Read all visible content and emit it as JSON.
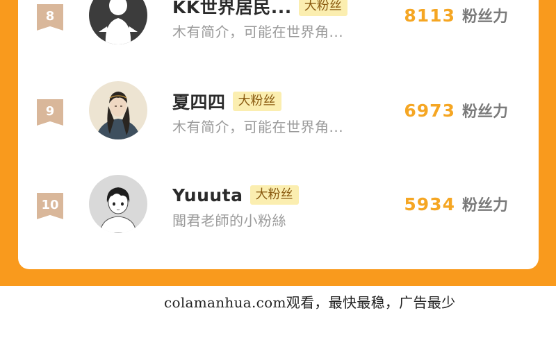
{
  "colors": {
    "frame_orange": "#f99a1d",
    "card_white": "#ffffff",
    "rank_badge": "#d9b79a",
    "fan_badge_bg": "#fbeeb0",
    "score_orange": "#f5a623",
    "bio_gray": "#9a9a9a"
  },
  "leaderboard": {
    "rows": [
      {
        "rank": "8",
        "avatar_icon": "default-ghost-avatar-icon",
        "name": "KK世界居民...",
        "badge": "大粉丝",
        "bio": "木有简介，可能在世界角...",
        "score": "8113",
        "score_unit": "粉丝力"
      },
      {
        "rank": "9",
        "avatar_icon": "illustrated-character-avatar-icon",
        "name": "夏四四",
        "badge": "大粉丝",
        "bio": "木有简介，可能在世界角...",
        "score": "6973",
        "score_unit": "粉丝力"
      },
      {
        "rank": "10",
        "avatar_icon": "anime-boy-avatar-icon",
        "name": "Yuuuta",
        "badge": "大粉丝",
        "bio": "聞君老師的小粉絲",
        "score": "5934",
        "score_unit": "粉丝力"
      }
    ]
  },
  "watermark": "colamanhua.com观看，最快最稳，广告最少"
}
